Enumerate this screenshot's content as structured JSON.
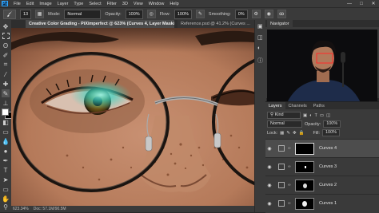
{
  "app": {
    "logo_text": "Ps"
  },
  "menu": [
    "File",
    "Edit",
    "Image",
    "Layer",
    "Type",
    "Select",
    "Filter",
    "3D",
    "View",
    "Window",
    "Help"
  ],
  "window_controls": {
    "minimize": "—",
    "maximize": "□",
    "close": "✕"
  },
  "options": {
    "mode_label": "Mode:",
    "mode_value": "Normal",
    "opacity_label": "Opacity:",
    "opacity_value": "100%",
    "flow_label": "Flow:",
    "flow_value": "100%",
    "smoothing_label": "Smoothing:",
    "smoothing_value": "0%",
    "brush_size": "13"
  },
  "tabs": [
    {
      "label": "Creative Color Grading - PiXimperfect @ 623% (Curves 4, Layer Mask/8) *",
      "active": true
    },
    {
      "label": "Reference.psd @ 41.2% (Curves ...",
      "active": false
    }
  ],
  "status": {
    "zoom": "623.34%",
    "doc": "Doc: 57.1M/90.5M"
  },
  "navigator": {
    "title": "Navigator"
  },
  "layers_panel": {
    "tabs": [
      "Layers",
      "Channels",
      "Paths"
    ],
    "kind_label": "Kind",
    "blend_mode": "Normal",
    "opacity_label": "Opacity:",
    "opacity_value": "100%",
    "lock_label": "Lock:",
    "fill_label": "Fill:",
    "fill_value": "100%",
    "layers": [
      {
        "name": "Curves 4",
        "selected": true
      },
      {
        "name": "Curves 3",
        "selected": false
      },
      {
        "name": "Curves 2",
        "selected": false
      },
      {
        "name": "Curves 1",
        "selected": false
      }
    ]
  },
  "colors": {
    "panel_bg": "#3a3a3a",
    "dark_bg": "#282828",
    "accent": "#31a8ff",
    "eye_glow": "#3ad6c4"
  },
  "icons": [
    "move-tool-icon",
    "marquee-tool-icon",
    "lasso-tool-icon",
    "quick-select-tool-icon",
    "crop-tool-icon",
    "eyedropper-tool-icon",
    "healing-brush-icon",
    "brush-tool-icon",
    "stamp-tool-icon",
    "history-brush-icon",
    "eraser-tool-icon",
    "gradient-tool-icon",
    "blur-tool-icon",
    "dodge-tool-icon",
    "pen-tool-icon",
    "type-tool-icon",
    "path-select-icon",
    "shape-tool-icon",
    "hand-tool-icon",
    "zoom-tool-icon",
    "foreground-color-swatch",
    "background-color-swatch",
    "eye-icon"
  ]
}
